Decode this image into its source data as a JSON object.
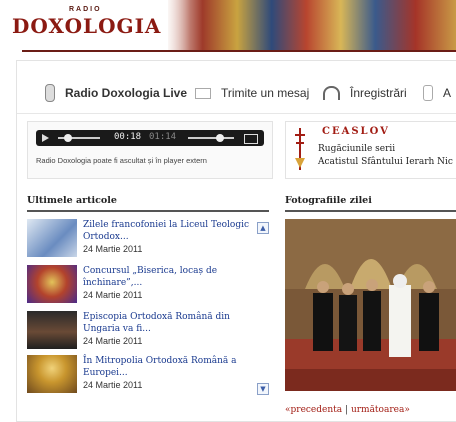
{
  "header": {
    "logo_small": "RADIO",
    "logo_main": "DOXOLOGIA"
  },
  "nav": {
    "items": [
      {
        "label": "Radio Doxologia Live",
        "icon": "microphone-icon"
      },
      {
        "label": "Trimite un mesaj",
        "icon": "envelope-icon"
      },
      {
        "label": "Înregistrări",
        "icon": "headphones-icon"
      },
      {
        "label": "A",
        "icon": "person-icon"
      }
    ]
  },
  "player": {
    "time_elapsed": "00:18",
    "time_total": "01:14",
    "note": "Radio Doxologia poate fi ascultat și în player extern"
  },
  "ceaslov": {
    "title": "CEASLOV",
    "line1": "Rugăciunile serii",
    "line2": "Acatistul Sfântului Ierarh Nic"
  },
  "articles": {
    "title": "Ultimele articole",
    "items": [
      {
        "title": "Zilele francofoniei la Liceul Teologic Ortodox...",
        "date": "24 Martie 2011"
      },
      {
        "title": "Concursul „Biserica, locaș de închinare”,...",
        "date": "24 Martie 2011"
      },
      {
        "title": "Episcopia Ortodoxă Română din Ungaria va fi...",
        "date": "24 Martie 2011"
      },
      {
        "title": "În Mitropolia Ortodoxă Română a Europei...",
        "date": "24 Martie 2011"
      }
    ]
  },
  "photos": {
    "title": "Fotografiile zilei",
    "prev": "«precedenta",
    "sep": "|",
    "next": "următoarea»"
  },
  "colors": {
    "brand": "#8b1a12",
    "link": "#1a3a8f",
    "accent": "#a21d14"
  }
}
